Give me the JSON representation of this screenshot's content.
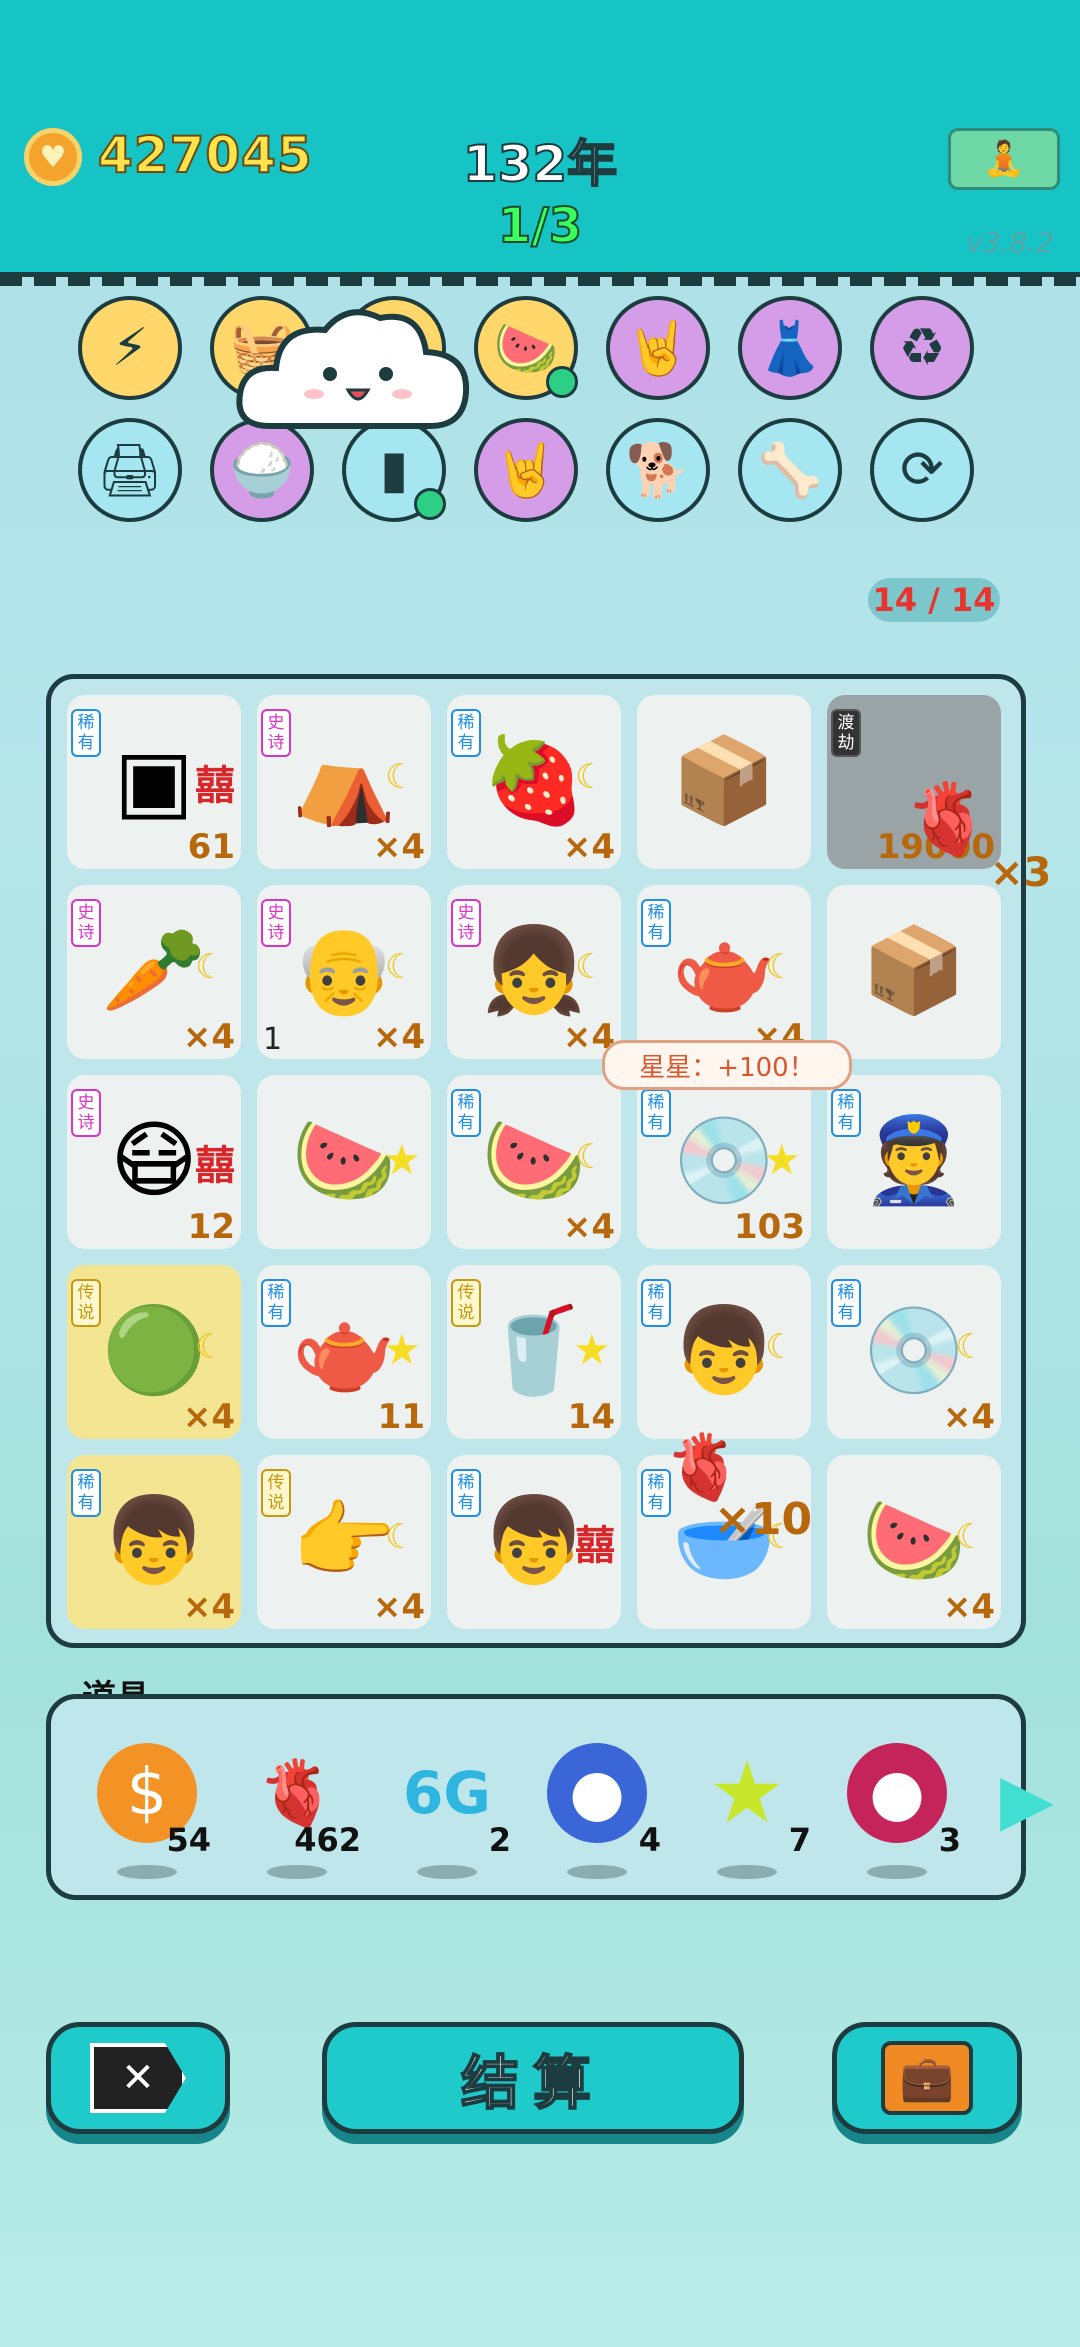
{
  "header": {
    "coins": "427045",
    "year": "132年",
    "round": "1/3",
    "version": "v3.8.2"
  },
  "icons": {
    "coin": "coin-heart-icon",
    "meditate": "meditation-icon"
  },
  "badges": [
    {
      "icon": "lightning-icon",
      "bg": "#ffd76a",
      "glyph": "⚡"
    },
    {
      "icon": "basket-icon",
      "bg": "#ffd76a",
      "glyph": "🧺"
    },
    {
      "icon": "hidden-icon",
      "bg": "#ffd76a",
      "glyph": ""
    },
    {
      "icon": "fruit-bowl-icon",
      "bg": "#ffd76a",
      "glyph": "🍉"
    },
    {
      "icon": "rock-hand-icon",
      "bg": "#d59de8",
      "glyph": "🤘"
    },
    {
      "icon": "skirt-icon",
      "bg": "#d59de8",
      "glyph": "👗"
    },
    {
      "icon": "recycle-icon",
      "bg": "#d59de8",
      "glyph": "♻"
    },
    {
      "icon": "printer-icon",
      "bg": "#a6e6f0",
      "glyph": "🖨"
    },
    {
      "icon": "rice-bowl-icon",
      "bg": "#d59de8",
      "glyph": "🍚"
    },
    {
      "icon": "bottle-icon",
      "bg": "#a6e6f0",
      "glyph": "▮"
    },
    {
      "icon": "rock-hand-icon",
      "bg": "#d59de8",
      "glyph": "🤘"
    },
    {
      "icon": "dog-icon",
      "bg": "#a6e6f0",
      "glyph": "🐕"
    },
    {
      "icon": "dog-bowl-icon",
      "bg": "#a6e6f0",
      "glyph": "🦴"
    },
    {
      "icon": "refresh-icon",
      "bg": "#a6e6f0",
      "glyph": "⟳"
    }
  ],
  "slot_counter": "14 / 14",
  "star_bubble": "星星：+100！",
  "cells": [
    {
      "tag": "稀有",
      "tagtype": "rare",
      "icon": "cpu-chip-icon",
      "glyph": "▣",
      "extra": "xi",
      "qty": "61"
    },
    {
      "tag": "史诗",
      "tagtype": "epic",
      "icon": "rabbit-tent-icon",
      "glyph": "⛺",
      "extra": "moon",
      "qty": "×4"
    },
    {
      "tag": "稀有",
      "tagtype": "rare",
      "icon": "lychee-icon",
      "glyph": "🍓",
      "extra": "moon",
      "qty": "×4"
    },
    {
      "tag": "",
      "tagtype": "",
      "icon": "box-icon",
      "glyph": "📦",
      "extra": "",
      "qty": ""
    },
    {
      "tag": "渡劫",
      "tagtype": "dj",
      "icon": "locked-item-icon",
      "glyph": "",
      "extra": "",
      "qty": "19000",
      "gray": true
    },
    {
      "tag": "史诗",
      "tagtype": "epic",
      "icon": "carrot-icon",
      "glyph": "🥕",
      "extra": "moon",
      "qty": "×4"
    },
    {
      "tag": "史诗",
      "tagtype": "epic",
      "icon": "old-man-icon",
      "glyph": "👴",
      "extra": "moon",
      "qty": "×4",
      "left": "1"
    },
    {
      "tag": "史诗",
      "tagtype": "epic",
      "icon": "girl-icon",
      "glyph": "👧",
      "extra": "moon",
      "qty": "×4"
    },
    {
      "tag": "稀有",
      "tagtype": "rare",
      "icon": "teapot-icon",
      "glyph": "🫖",
      "extra": "moon",
      "qty": "×4"
    },
    {
      "tag": "",
      "tagtype": "",
      "icon": "box-icon",
      "glyph": "📦",
      "extra": "",
      "qty": ""
    },
    {
      "tag": "史诗",
      "tagtype": "epic",
      "icon": "masked-man-icon",
      "glyph": "😷",
      "extra": "xi",
      "qty": "12"
    },
    {
      "tag": "",
      "tagtype": "",
      "icon": "watermelon-slice-icon",
      "glyph": "🍉",
      "extra": "star",
      "qty": ""
    },
    {
      "tag": "稀有",
      "tagtype": "rare",
      "icon": "watermelon-icon",
      "glyph": "🍉",
      "extra": "moon",
      "qty": "×4"
    },
    {
      "tag": "稀有",
      "tagtype": "rare",
      "icon": "disc-icon",
      "glyph": "💿",
      "extra": "star",
      "qty": "103"
    },
    {
      "tag": "稀有",
      "tagtype": "rare",
      "icon": "police-icon",
      "glyph": "👮",
      "extra": "",
      "qty": ""
    },
    {
      "tag": "传说",
      "tagtype": "leg",
      "icon": "melon-icon",
      "glyph": "🟢",
      "extra": "moon",
      "qty": "×4",
      "gold": true
    },
    {
      "tag": "稀有",
      "tagtype": "rare",
      "icon": "teapot-icon",
      "glyph": "🫖",
      "extra": "star",
      "qty": "11"
    },
    {
      "tag": "传说",
      "tagtype": "leg",
      "icon": "bubble-tea-icon",
      "glyph": "🥤",
      "extra": "star",
      "qty": "14"
    },
    {
      "tag": "稀有",
      "tagtype": "rare",
      "icon": "boy-icon",
      "glyph": "👦",
      "extra": "moon",
      "qty": ""
    },
    {
      "tag": "稀有",
      "tagtype": "rare",
      "icon": "disc-icon",
      "glyph": "💿",
      "extra": "moon",
      "qty": "×4"
    },
    {
      "tag": "稀有",
      "tagtype": "rare",
      "icon": "boy-face-icon",
      "glyph": "👦",
      "extra": "",
      "qty": "×4",
      "gold": true
    },
    {
      "tag": "传说",
      "tagtype": "leg",
      "icon": "pointing-hand-icon",
      "glyph": "👉",
      "extra": "moon",
      "qty": "×4"
    },
    {
      "tag": "稀有",
      "tagtype": "rare",
      "icon": "boy-icon",
      "glyph": "👦",
      "extra": "xi",
      "qty": ""
    },
    {
      "tag": "稀有",
      "tagtype": "rare",
      "icon": "rice-bowl-icon",
      "glyph": "🥣",
      "extra": "moon",
      "qty": ""
    },
    {
      "tag": "",
      "tagtype": "",
      "icon": "watermelon-slice-icon",
      "glyph": "🍉",
      "extra": "moon",
      "qty": "×4"
    }
  ],
  "float": {
    "x3": "×3",
    "x10": "×10"
  },
  "props_label": "道具",
  "props": [
    {
      "icon": "dollar-coin-icon",
      "bg": "#f39325",
      "glyph": "$",
      "count": "54"
    },
    {
      "icon": "liver-icon",
      "bg": "transparent",
      "glyph": "🫀",
      "count": "462"
    },
    {
      "icon": "6g-icon",
      "bg": "transparent",
      "glyph": "6G",
      "count": "2"
    },
    {
      "icon": "blueberry-icon",
      "bg": "#3a66d8",
      "glyph": "●",
      "count": "4"
    },
    {
      "icon": "star-icon",
      "bg": "transparent",
      "glyph": "★",
      "count": "7"
    },
    {
      "icon": "lychee-icon",
      "bg": "#c4245a",
      "glyph": "●",
      "count": "3"
    }
  ],
  "buttons": {
    "clear": "clear-icon",
    "settle": "结算",
    "bag": "briefcase-icon"
  }
}
